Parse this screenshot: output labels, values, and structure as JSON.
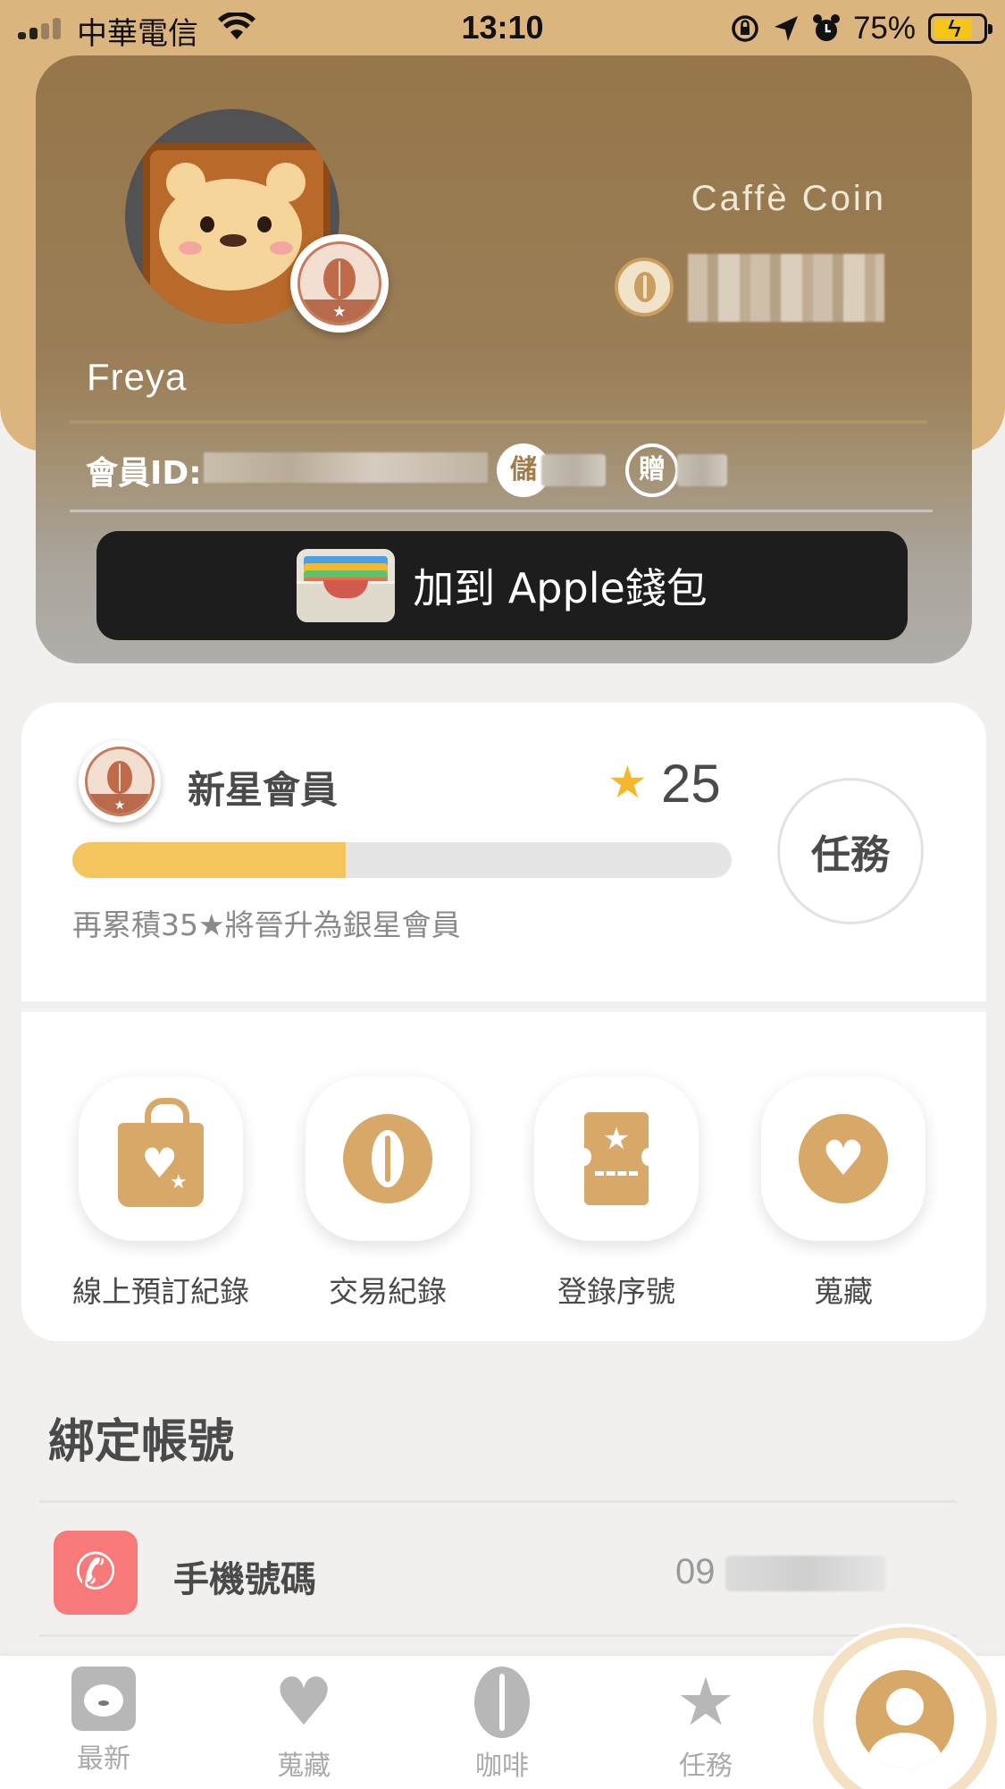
{
  "status_bar": {
    "carrier": "中華電信",
    "time": "13:10",
    "battery_percent": "75%"
  },
  "member_card": {
    "username": "Freya",
    "caffe_coin_label": "Caffè Coin",
    "member_id_label": "會員ID:",
    "stored_label": "儲",
    "gift_label": "贈",
    "wallet_button": "加到 Apple錢包"
  },
  "level": {
    "name": "新星會員",
    "stars": "25",
    "progress": 0.415,
    "hint": "再累積35★將晉升為銀星會員",
    "mission_button": "任務"
  },
  "actions": [
    {
      "label": "線上預訂紀錄",
      "icon": "shopping-bag-icon"
    },
    {
      "label": "交易紀錄",
      "icon": "coffee-bean-icon"
    },
    {
      "label": "登錄序號",
      "icon": "ticket-icon"
    },
    {
      "label": "蒐藏",
      "icon": "heart-icon"
    }
  ],
  "linked_accounts": {
    "title": "綁定帳號",
    "rows": [
      {
        "label": "手機號碼",
        "value": "09",
        "icon": "phone-icon"
      }
    ]
  },
  "tabs": [
    {
      "label": "最新",
      "icon": "bear-icon"
    },
    {
      "label": "蒐藏",
      "icon": "heart-icon"
    },
    {
      "label": "咖啡",
      "icon": "coffee-bean-icon"
    },
    {
      "label": "任務",
      "icon": "star-icon"
    },
    {
      "label": "",
      "icon": "profile-icon",
      "active": true
    }
  ],
  "colors": {
    "header": "#dcb57e",
    "accent": "#d7a867",
    "progress_fill": "#f4c55c",
    "star": "#f4b72e",
    "phone_icon_bg": "#f7797a"
  }
}
